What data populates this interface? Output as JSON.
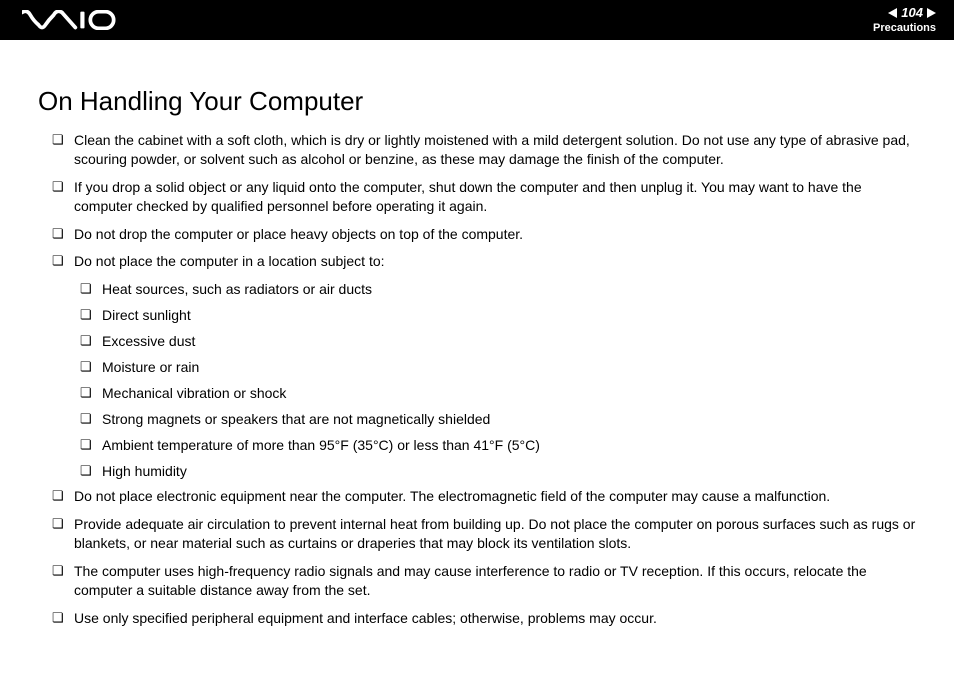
{
  "header": {
    "page_number": "104",
    "breadcrumb": "Precautions"
  },
  "title": "On Handling Your Computer",
  "bullets": {
    "b1": "Clean the cabinet with a soft cloth, which is dry or lightly moistened with a mild detergent solution. Do not use any type of abrasive pad, scouring powder, or solvent such as alcohol or benzine, as these may damage the finish of the computer.",
    "b2": "If you drop a solid object or any liquid onto the computer, shut down the computer and then unplug it. You may want to have the computer checked by qualified personnel before operating it again.",
    "b3": "Do not drop the computer or place heavy objects on top of the computer.",
    "b4": "Do not place the computer in a location subject to:",
    "b4_sub": {
      "s1": "Heat sources, such as radiators or air ducts",
      "s2": "Direct sunlight",
      "s3": "Excessive dust",
      "s4": "Moisture or rain",
      "s5": "Mechanical vibration or shock",
      "s6": "Strong magnets or speakers that are not magnetically shielded",
      "s7": "Ambient temperature of more than 95°F (35°C) or less than 41°F (5°C)",
      "s8": "High humidity"
    },
    "b5": "Do not place electronic equipment near the computer. The electromagnetic field of the computer may cause a malfunction.",
    "b6": "Provide adequate air circulation to prevent internal heat from building up. Do not place the computer on porous surfaces such as rugs or blankets, or near material such as curtains or draperies that may block its ventilation slots.",
    "b7": "The computer uses high-frequency radio signals and may cause interference to radio or TV reception. If this occurs, relocate the computer a suitable distance away from the set.",
    "b8": "Use only specified peripheral equipment and interface cables; otherwise, problems may occur."
  }
}
